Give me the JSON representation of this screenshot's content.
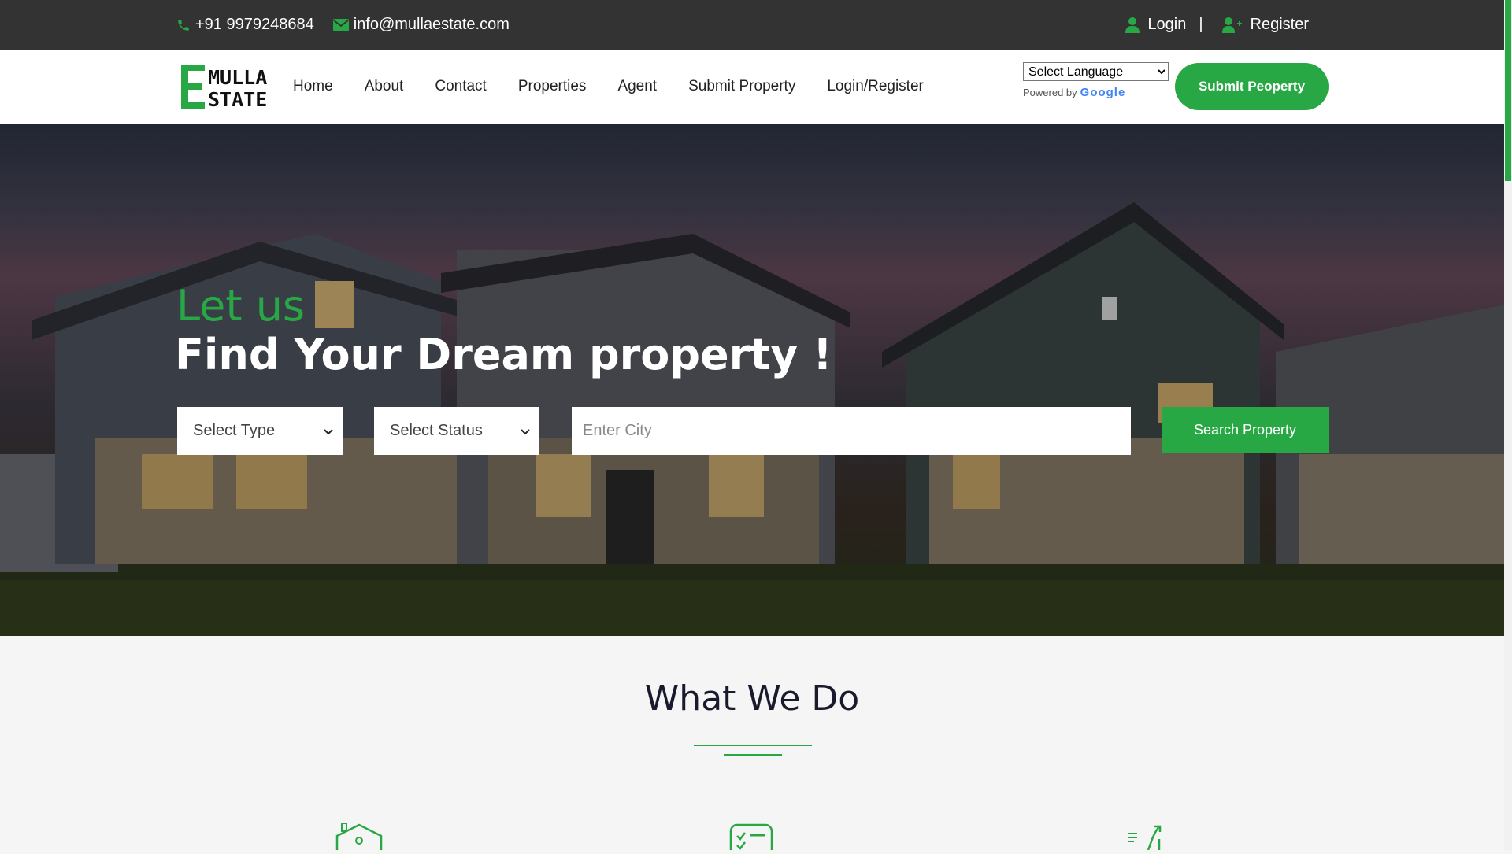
{
  "topbar": {
    "phone": "+91 9979248684",
    "email": "info@mullaestate.com",
    "login": "Login",
    "separator": "|",
    "register": "Register"
  },
  "brand": {
    "logo_line1": "MULLA",
    "logo_line2": "STATE",
    "logo_letter": "E"
  },
  "nav": {
    "items": [
      "Home",
      "About",
      "Contact",
      "Properties",
      "Agent",
      "Submit Property",
      "Login/Register"
    ]
  },
  "translate": {
    "selected": "Select Language",
    "powered_by": "Powered by",
    "google": "Google"
  },
  "cta": {
    "submit_label": "Submit Peoperty"
  },
  "hero": {
    "kicker": "Let us",
    "headline": "Find Your Dream property !",
    "type_select": "Select Type",
    "status_select": "Select Status",
    "city_placeholder": "Enter City",
    "search_label": "Search Property"
  },
  "section": {
    "title": "What We Do"
  },
  "icons": {
    "phone": "phone-icon",
    "email": "envelope-icon",
    "login": "user-icon",
    "register": "user-plus-icon",
    "features": [
      "house-search-icon",
      "checklist-card-icon",
      "growth-chart-icon"
    ]
  },
  "colors": {
    "accent": "#28a745",
    "topbar_bg": "#333333",
    "heading": "#1a1a2e"
  }
}
